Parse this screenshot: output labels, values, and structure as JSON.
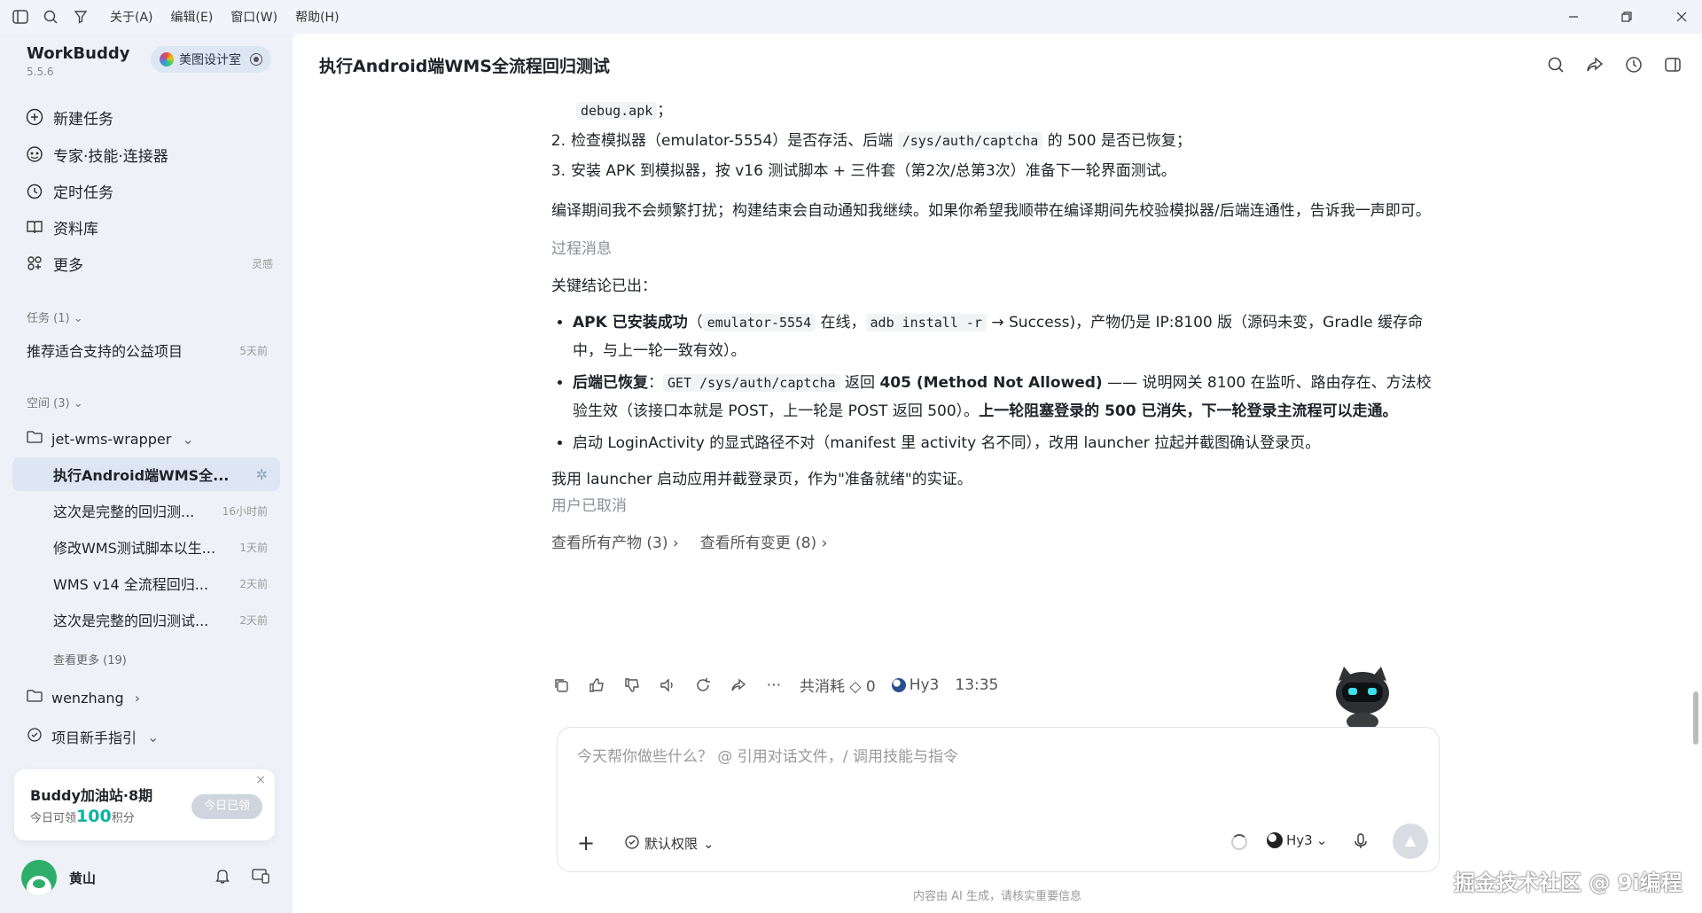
{
  "menubar": {
    "items": [
      "关于(A)",
      "编辑(E)",
      "窗口(W)",
      "帮助(H)"
    ]
  },
  "sidebar": {
    "brand": "WorkBuddy",
    "version": "5.5.6",
    "studio": "美图设计室",
    "nav": [
      {
        "label": "新建任务",
        "icon": "plus-circle-icon"
      },
      {
        "label": "专家·技能·连接器",
        "icon": "expert-icon"
      },
      {
        "label": "定时任务",
        "icon": "clock-icon"
      },
      {
        "label": "资料库",
        "icon": "book-icon"
      },
      {
        "label": "更多",
        "icon": "grid-icon",
        "hint": "灵感"
      }
    ],
    "tasks_header": "任务 (1)",
    "tasks": [
      {
        "label": "推荐适合支持的公益项目",
        "meta": "5天前"
      }
    ],
    "spaces_header": "空间 (3)",
    "space1": "jet-wms-wrapper",
    "space1_items": [
      {
        "label": "执行Android端WMS全...",
        "meta": ""
      },
      {
        "label": "这次是完整的回归测...",
        "meta": "16小时前"
      },
      {
        "label": "修改WMS测试脚本以生...",
        "meta": "1天前"
      },
      {
        "label": "WMS v14 全流程回归...",
        "meta": "2天前"
      },
      {
        "label": "这次是完整的回归测试...",
        "meta": "2天前"
      }
    ],
    "see_more": "查看更多 (19)",
    "space2": "wenzhang",
    "space3": "项目新手指引",
    "promo": {
      "title": "Buddy加油站·8期",
      "prefix": "今日可领",
      "amount": "100",
      "suffix": "积分",
      "button": "今日已领"
    },
    "user": {
      "name": "黄山"
    }
  },
  "main": {
    "title": "执行Android端WMS全流程回归测试",
    "lines": {
      "l0_code": "debug.apk",
      "l0_tail": "；",
      "l1_num": "2.",
      "l1_a": "检查模拟器（emulator-5554）是否存活、后端",
      "l1_code": "/sys/auth/captcha",
      "l1_b": "的 500 是否已恢复；",
      "l2_num": "3.",
      "l2": "安装 APK 到模拟器，按 v16 测试脚本 + 三件套（第2次/总第3次）准备下一轮界面测试。",
      "p1": "编译期间我不会频繁打扰；构建结束会自动通知我继续。如果你希望我顺带在编译期间先校验模拟器/后端连通性，告诉我一声即可。",
      "process": "过程消息",
      "conclusion": "关键结论已出：",
      "b1_bold": "APK 已安装成功",
      "b1_a": "（",
      "b1_code1": "emulator-5554",
      "b1_b": " 在线，",
      "b1_code2": "adb install -r",
      "b1_c": " → Success)，产物仍是 IP:8100 版（源码未变，Gradle 缓存命中，与上一轮一致有效）。",
      "b2_bold": "后端已恢复",
      "b2_a": "：",
      "b2_code": "GET /sys/auth/captcha",
      "b2_b": " 返回 ",
      "b2_bold2": "405 (Method Not Allowed)",
      "b2_c": " —— 说明网关 8100 在监听、路由存在、方法校验生效（该接口本就是 POST，上一轮是 POST 返回 500）。",
      "b2_bold3": "上一轮阻塞登录的 500 已消失，下一轮登录主流程可以走通。",
      "b3": "启动 LoginActivity 的显式路径不对（manifest 里 activity 名不同），改用 launcher 拉起并截图确认登录页。",
      "p2": "我用 launcher 启动应用并截登录页，作为\"准备就绪\"的实证。",
      "cancelled": "用户已取消",
      "link1": "查看所有产物 (3)",
      "link2": "查看所有变更 (8)"
    },
    "actions": {
      "consume": "共消耗 ◇ 0",
      "model": "Hy3",
      "time": "13:35"
    },
    "composer": {
      "placeholder": "今天帮你做些什么？ @ 引用对话文件，/ 调用技能与指令",
      "permission": "默认权限",
      "model": "Hy3"
    },
    "footer": "内容由 AI 生成，请核实重要信息"
  },
  "watermark": "掘金技术社区 @ 9i编程"
}
